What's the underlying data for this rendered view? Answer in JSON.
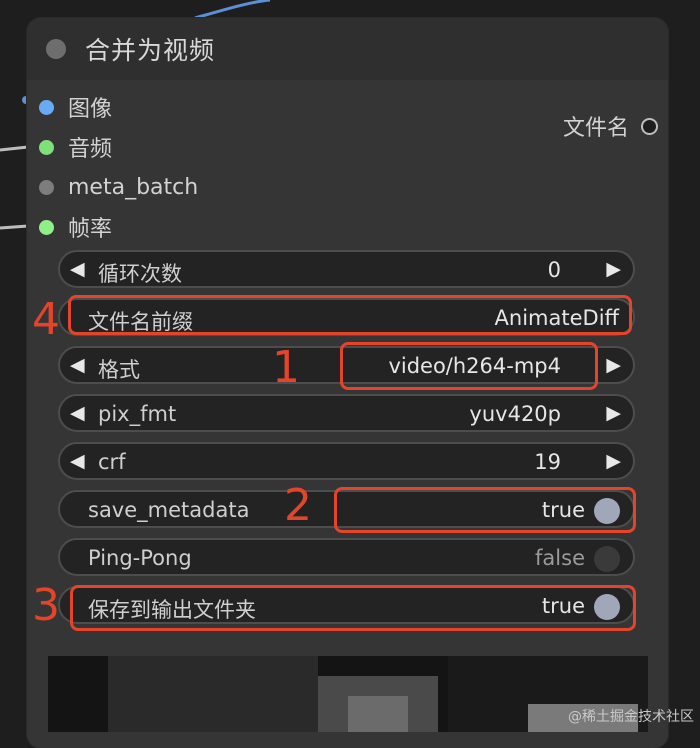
{
  "node": {
    "title": "合并为视频",
    "inputs": [
      {
        "label": "图像",
        "color": "#6aa9f5"
      },
      {
        "label": "音频",
        "color": "#7ee07a"
      },
      {
        "label": "meta_batch",
        "color": "#7d7d7d"
      },
      {
        "label": "帧率",
        "color": "#8ff08a"
      }
    ],
    "output": {
      "label": "文件名"
    }
  },
  "widgets": {
    "loop_count": {
      "label": "循环次数",
      "value": "0"
    },
    "filename_prefix": {
      "label": "文件名前缀",
      "value": "AnimateDiff"
    },
    "format": {
      "label": "格式",
      "value": "video/h264-mp4"
    },
    "pix_fmt": {
      "label": "pix_fmt",
      "value": "yuv420p"
    },
    "crf": {
      "label": "crf",
      "value": "19"
    },
    "save_metadata": {
      "label": "save_metadata",
      "value": "true"
    },
    "pingpong": {
      "label": "Ping-Pong",
      "value": "false"
    },
    "save_output": {
      "label": "保存到输出文件夹",
      "value": "true"
    }
  },
  "arrows": {
    "left": "◀",
    "right": "▶"
  },
  "highlights": {
    "n1": "1",
    "n2": "2",
    "n3": "3",
    "n4": "4"
  },
  "watermark": "@稀土掘金技术社区",
  "colors": {
    "highlight": "#e3442a",
    "toggle_on": "#a0a7b8",
    "toggle_off": "#3a3a3a"
  }
}
